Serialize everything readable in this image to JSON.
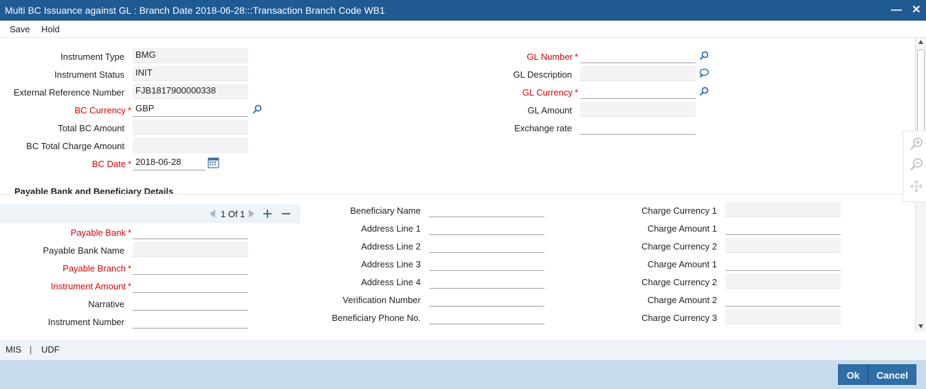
{
  "window": {
    "title": "Multi BC Issuance against GL : Branch Date 2018-06-28:::Transaction Branch Code WB1",
    "minimize_icon": "minimize-icon",
    "close_icon": "close-icon"
  },
  "menu": {
    "save": "Save",
    "hold": "Hold"
  },
  "header_left": {
    "instrument_type": {
      "label": "Instrument Type",
      "value": "BMG"
    },
    "instrument_status": {
      "label": "Instrument Status",
      "value": "INIT"
    },
    "external_ref": {
      "label": "External Reference Number",
      "value": "FJB1817900000338"
    },
    "bc_currency": {
      "label": "BC Currency",
      "value": "GBP",
      "required": true
    },
    "total_bc_amount": {
      "label": "Total BC Amount",
      "value": ""
    },
    "bc_total_charge": {
      "label": "BC Total Charge Amount",
      "value": ""
    },
    "bc_date": {
      "label": "BC Date",
      "value": "2018-06-28",
      "required": true
    }
  },
  "header_right": {
    "gl_number": {
      "label": "GL Number",
      "value": "",
      "required": true
    },
    "gl_description": {
      "label": "GL Description",
      "value": ""
    },
    "gl_currency": {
      "label": "GL Currency",
      "value": "",
      "required": true
    },
    "gl_amount": {
      "label": "GL Amount",
      "value": ""
    },
    "exchange_rate": {
      "label": "Exchange rate",
      "value": ""
    }
  },
  "required_marker": "*",
  "section": {
    "title": "Payable Bank and Beneficiary Details",
    "pager": {
      "text": "1 Of 1"
    }
  },
  "payable": {
    "payable_bank": {
      "label": "Payable Bank",
      "value": "",
      "required": true
    },
    "payable_bank_name": {
      "label": "Payable Bank Name",
      "value": ""
    },
    "payable_branch": {
      "label": "Payable Branch",
      "value": "",
      "required": true
    },
    "instrument_amount": {
      "label": "Instrument Amount",
      "value": "",
      "required": true
    },
    "narrative": {
      "label": "Narrative",
      "value": ""
    },
    "instrument_number": {
      "label": "Instrument Number",
      "value": ""
    }
  },
  "beneficiary": {
    "name": {
      "label": "Beneficiary Name",
      "value": ""
    },
    "address1": {
      "label": "Address Line 1",
      "value": ""
    },
    "address2": {
      "label": "Address Line 2",
      "value": ""
    },
    "address3": {
      "label": "Address Line 3",
      "value": ""
    },
    "address4": {
      "label": "Address Line 4",
      "value": ""
    },
    "verification": {
      "label": "Verification Number",
      "value": ""
    },
    "phone": {
      "label": "Beneficiary Phone No.",
      "value": ""
    }
  },
  "charges": [
    {
      "label": "Charge Currency 1",
      "value": "",
      "readonly": true
    },
    {
      "label": "Charge Amount 1",
      "value": "",
      "readonly": false
    },
    {
      "label": "Charge Currency 2",
      "value": "",
      "readonly": true
    },
    {
      "label": "Charge Amount 1",
      "value": "",
      "readonly": false
    },
    {
      "label": "Charge Currency 2",
      "value": "",
      "readonly": true
    },
    {
      "label": "Charge Amount 2",
      "value": "",
      "readonly": false
    },
    {
      "label": "Charge Currency 3",
      "value": "",
      "readonly": true
    }
  ],
  "footer": {
    "mis": "MIS",
    "separator": "|",
    "udf": "UDF"
  },
  "buttons": {
    "ok": "Ok",
    "cancel": "Cancel"
  },
  "colors": {
    "titlebar": "#1f5a93",
    "required": "#e00000",
    "button": "#2f6fa8",
    "lookup": "#2a6ebb"
  }
}
